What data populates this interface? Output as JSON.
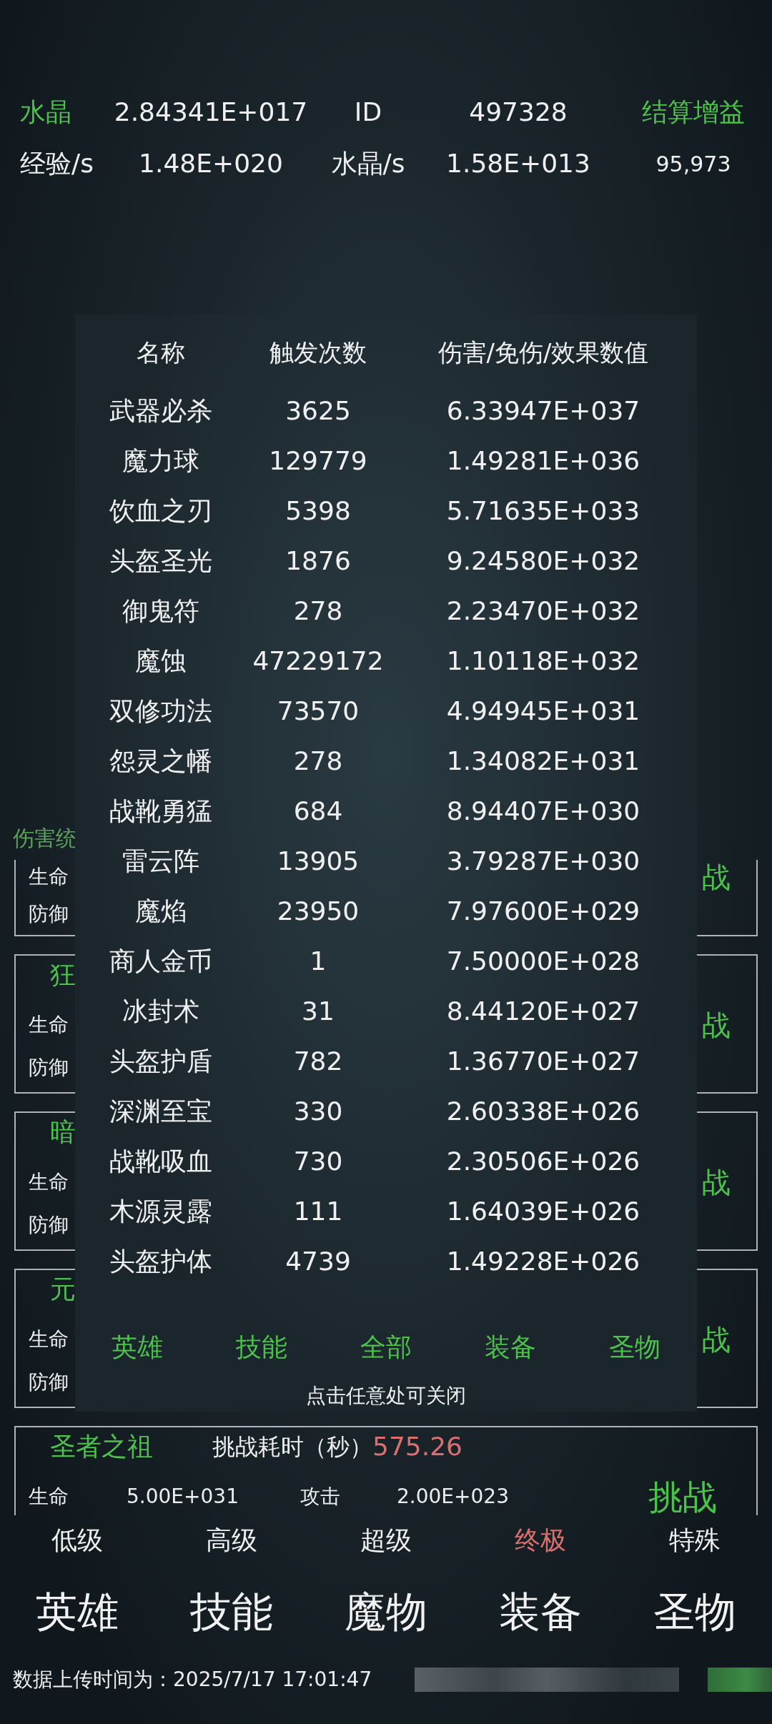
{
  "stats_rows": [
    [
      {
        "text": "水晶",
        "highlight": true
      },
      {
        "text": "2.84341E+017",
        "highlight": false
      },
      {
        "text": "ID",
        "highlight": false
      },
      {
        "text": "497328",
        "highlight": false
      },
      {
        "text": "结算增益",
        "highlight": true
      }
    ],
    [
      {
        "text": "经验/s",
        "highlight": false
      },
      {
        "text": "1.48E+020",
        "highlight": false
      },
      {
        "text": "水晶/s",
        "highlight": false
      },
      {
        "text": "1.58E+013",
        "highlight": false
      },
      {
        "text": "95,973",
        "highlight": false
      }
    ]
  ],
  "section_label": "伤害统",
  "cards": [
    {
      "kind": "partial",
      "stats": [
        {
          "label": "生命"
        },
        {
          "label": "防御"
        }
      ],
      "action": "战"
    },
    {
      "kind": "partial",
      "title": "狂",
      "stats": [
        {
          "label": "生命"
        },
        {
          "label": "防御"
        }
      ],
      "action": "战"
    },
    {
      "kind": "partial",
      "title": "暗",
      "stats": [
        {
          "label": "生命"
        },
        {
          "label": "防御"
        }
      ],
      "action": "战"
    },
    {
      "kind": "partial",
      "title": "元",
      "stats": [
        {
          "label": "生命"
        },
        {
          "label": "防御"
        }
      ],
      "action": "战"
    },
    {
      "kind": "full",
      "title": "圣者之祖",
      "time_label": "挑战耗时（秒）",
      "time": "575.26",
      "stats": [
        {
          "label": "生命",
          "value": "5.00E+031"
        },
        {
          "label": "攻击",
          "value": "2.00E+023"
        }
      ],
      "action": "挑战"
    }
  ],
  "levels": [
    {
      "label": "低级",
      "selected": false
    },
    {
      "label": "高级",
      "selected": false
    },
    {
      "label": "超级",
      "selected": false
    },
    {
      "label": "终极",
      "selected": true
    },
    {
      "label": "特殊",
      "selected": false
    }
  ],
  "nav": [
    "英雄",
    "技能",
    "魔物",
    "装备",
    "圣物"
  ],
  "footer": "数据上传时间为：2025/7/17 17:01:47",
  "overlay": {
    "columns": [
      "名称",
      "触发次数",
      "伤害/免伤/效果数值"
    ],
    "rows": [
      {
        "name": "武器必杀",
        "count": "3625",
        "value": "6.33947E+037"
      },
      {
        "name": "魔力球",
        "count": "129779",
        "value": "1.49281E+036"
      },
      {
        "name": "饮血之刃",
        "count": "5398",
        "value": "5.71635E+033"
      },
      {
        "name": "头盔圣光",
        "count": "1876",
        "value": "9.24580E+032"
      },
      {
        "name": "御鬼符",
        "count": "278",
        "value": "2.23470E+032"
      },
      {
        "name": "魔蚀",
        "count": "47229172",
        "value": "1.10118E+032"
      },
      {
        "name": "双修功法",
        "count": "73570",
        "value": "4.94945E+031"
      },
      {
        "name": "怨灵之幡",
        "count": "278",
        "value": "1.34082E+031"
      },
      {
        "name": "战靴勇猛",
        "count": "684",
        "value": "8.94407E+030"
      },
      {
        "name": "雷云阵",
        "count": "13905",
        "value": "3.79287E+030"
      },
      {
        "name": "魔焰",
        "count": "23950",
        "value": "7.97600E+029"
      },
      {
        "name": "商人金币",
        "count": "1",
        "value": "7.50000E+028"
      },
      {
        "name": "冰封术",
        "count": "31",
        "value": "8.44120E+027"
      },
      {
        "name": "头盔护盾",
        "count": "782",
        "value": "1.36770E+027"
      },
      {
        "name": "深渊至宝",
        "count": "330",
        "value": "2.60338E+026"
      },
      {
        "name": "战靴吸血",
        "count": "730",
        "value": "2.30506E+026"
      },
      {
        "name": "木源灵露",
        "count": "111",
        "value": "1.64039E+026"
      },
      {
        "name": "头盔护体",
        "count": "4739",
        "value": "1.49228E+026"
      }
    ],
    "tabs": [
      "英雄",
      "技能",
      "全部",
      "装备",
      "圣物"
    ],
    "close_hint": "点击任意处可关闭"
  }
}
